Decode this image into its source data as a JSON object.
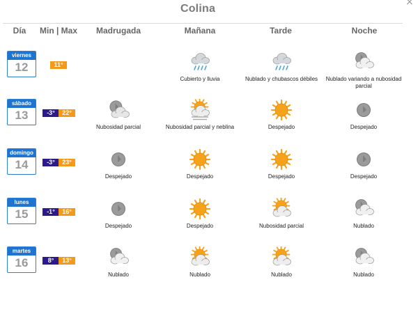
{
  "title": "Colina",
  "close_glyph": "×",
  "headers": {
    "day": "Día",
    "minmax": "Min | Max",
    "madrugada": "Madrugada",
    "manana": "Mañana",
    "tarde": "Tarde",
    "noche": "Noche"
  },
  "days": [
    {
      "name": "viernes",
      "num": "12",
      "min": "",
      "max": "11°",
      "madrugada": {
        "icon": "",
        "label": ""
      },
      "manana": {
        "icon": "cloud-rain-icon",
        "label": "Cubierto y lluvia"
      },
      "tarde": {
        "icon": "cloud-rain-icon",
        "label": "Nublado y chubascos débiles"
      },
      "noche": {
        "icon": "cloudy-night-icon",
        "label": "Nublado variando a nubosidad parcial"
      }
    },
    {
      "name": "sábado",
      "num": "13",
      "min": "-3°",
      "max": "22°",
      "madrugada": {
        "icon": "partly-cloudy-night-icon",
        "label": "Nubosidad parcial"
      },
      "manana": {
        "icon": "sun-cloud-fog-icon",
        "label": "Nubosidad parcial y neblina"
      },
      "tarde": {
        "icon": "sun-icon",
        "label": "Despejado"
      },
      "noche": {
        "icon": "moon-icon",
        "label": "Despejado"
      }
    },
    {
      "name": "domingo",
      "num": "14",
      "min": "-3°",
      "max": "23°",
      "madrugada": {
        "icon": "moon-icon",
        "label": "Despejado"
      },
      "manana": {
        "icon": "sun-icon",
        "label": "Despejado"
      },
      "tarde": {
        "icon": "sun-icon",
        "label": "Despejado"
      },
      "noche": {
        "icon": "moon-icon",
        "label": "Despejado"
      }
    },
    {
      "name": "lunes",
      "num": "15",
      "min": "-1°",
      "max": "16°",
      "madrugada": {
        "icon": "moon-icon",
        "label": "Despejado"
      },
      "manana": {
        "icon": "sun-icon",
        "label": "Despejado"
      },
      "tarde": {
        "icon": "sun-cloud-icon",
        "label": "Nubosidad parcial"
      },
      "noche": {
        "icon": "cloudy-night-icon",
        "label": "Nublado"
      }
    },
    {
      "name": "martes",
      "num": "16",
      "min": "8°",
      "max": "13°",
      "madrugada": {
        "icon": "cloudy-night-icon",
        "label": "Nublado"
      },
      "manana": {
        "icon": "sun-cloud-icon",
        "label": "Nublado"
      },
      "tarde": {
        "icon": "sun-cloud-icon",
        "label": "Nublado"
      },
      "noche": {
        "icon": "cloudy-night-icon",
        "label": "Nublado"
      }
    }
  ],
  "colors": {
    "cal_blue": "#1f74d1",
    "min_bg": "#2c1a8c",
    "max_bg": "#f39a1a",
    "sun": "#f7a21b",
    "moon": "#8a8a8a",
    "cloud": "#d6d6d6"
  }
}
